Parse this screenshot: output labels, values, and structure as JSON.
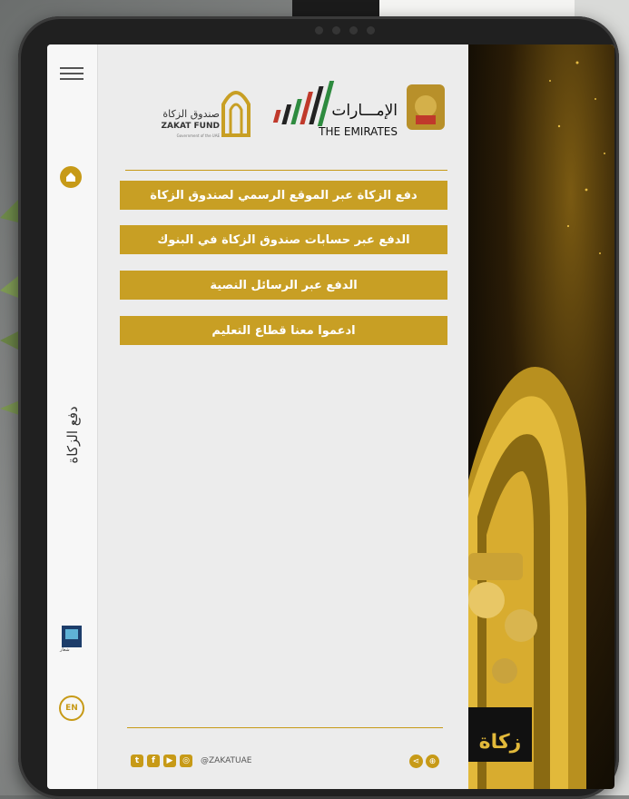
{
  "logos": {
    "emirates_ar": "الإمـــارات",
    "emirates_en": "THE EMIRATES",
    "zakat_ar": "صندوق الزكاة",
    "zakat_en": "ZAKAT FUND",
    "zakat_sub": "Government of the UAE"
  },
  "sidebar": {
    "vertical_label": "دفع الزكاة",
    "language_button": "EN",
    "accessibility_caption": "شعار"
  },
  "menu": {
    "items": [
      {
        "label": "دفع الزكاة عبر الموقع الرسمي لصندوق الزكاة"
      },
      {
        "label": "الدفع عبر حسابات صندوق الزكاة في البنوك"
      },
      {
        "label": "الدفع عبر الرسائل النصية"
      },
      {
        "label": "ادعموا معنا قطاع التعليم"
      }
    ]
  },
  "footer": {
    "social_handle": "@ZAKATUAE",
    "icons": [
      "twitter-icon",
      "facebook-icon",
      "youtube-icon",
      "instagram-icon"
    ],
    "right_icons": [
      "share-icon",
      "globe-icon"
    ]
  },
  "hero": {
    "caption": "زكاة"
  },
  "colors": {
    "accent": "#c89f24",
    "panel_bg": "#ececec",
    "hero_dark": "#0f0b04"
  }
}
